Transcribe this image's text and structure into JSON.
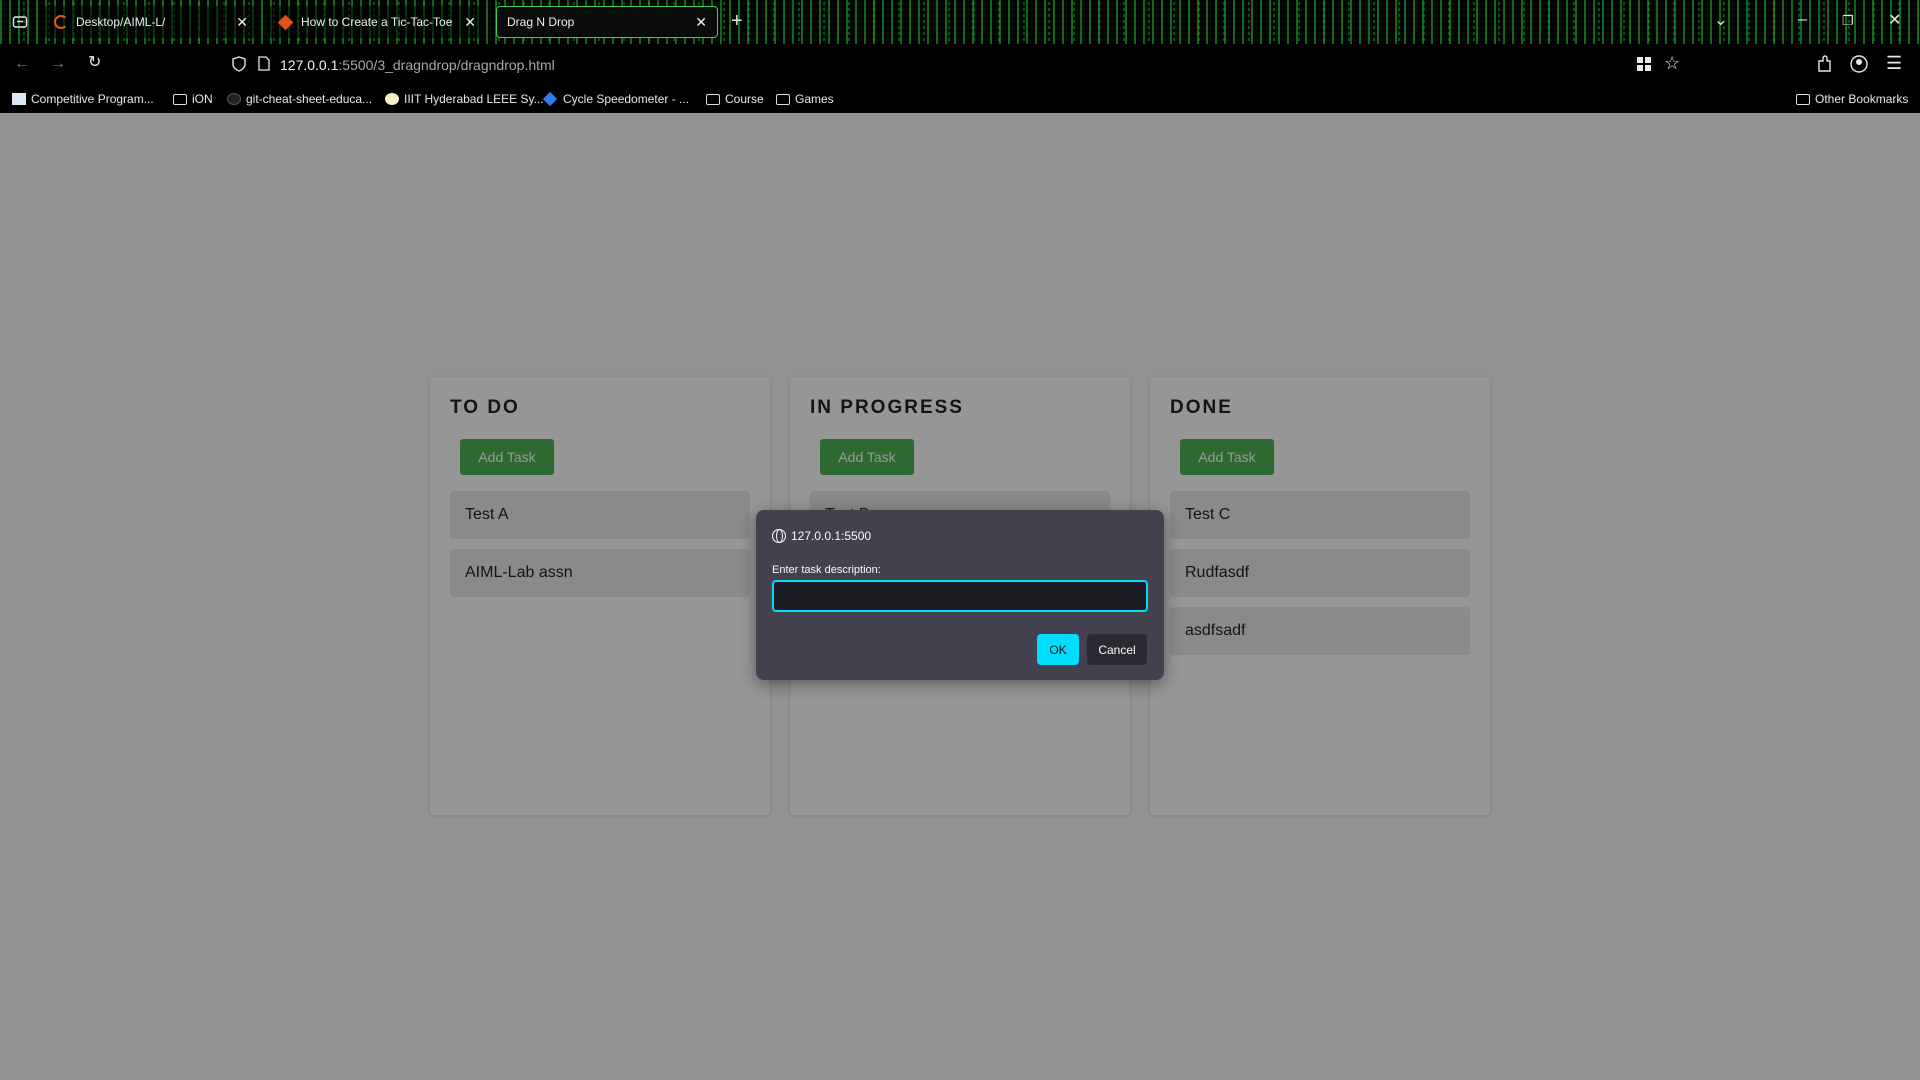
{
  "browser": {
    "tabs": [
      {
        "title": "Desktop/AIML-L/",
        "icon": "loading-ring-icon"
      },
      {
        "title": "How to Create a Tic-Tac-Toe Ga",
        "icon": "gitlab-diamond-icon"
      },
      {
        "title": "Drag N Drop",
        "icon": ""
      }
    ],
    "url_host": "127.0.0.1",
    "url_path": ":5500/3_dragndrop/dragndrop.html",
    "bookmarks": [
      "Competitive Program...",
      "iON",
      "git-cheat-sheet-educa...",
      "IIIT Hyderabad LEEE Sy...",
      "Cycle Speedometer - ...",
      "Course",
      "Games"
    ],
    "other_bookmarks": "Other Bookmarks"
  },
  "board": {
    "columns": [
      {
        "title": "TO DO",
        "add_label": "Add Task",
        "tasks": [
          "Test A",
          "AIML-Lab assn"
        ]
      },
      {
        "title": "IN PROGRESS",
        "add_label": "Add Task",
        "tasks": [
          "Test B"
        ]
      },
      {
        "title": "DONE",
        "add_label": "Add Task",
        "tasks": [
          "Test C",
          "Rudfasdf",
          "asdfsadf"
        ]
      }
    ]
  },
  "dialog": {
    "origin": "127.0.0.1:5500",
    "label": "Enter task description:",
    "input_value": "",
    "ok_label": "OK",
    "cancel_label": "Cancel",
    "accent_color": "#00ddff"
  },
  "colors": {
    "add_button": "#4caf50",
    "tab_active_border": "#3fd15a"
  }
}
